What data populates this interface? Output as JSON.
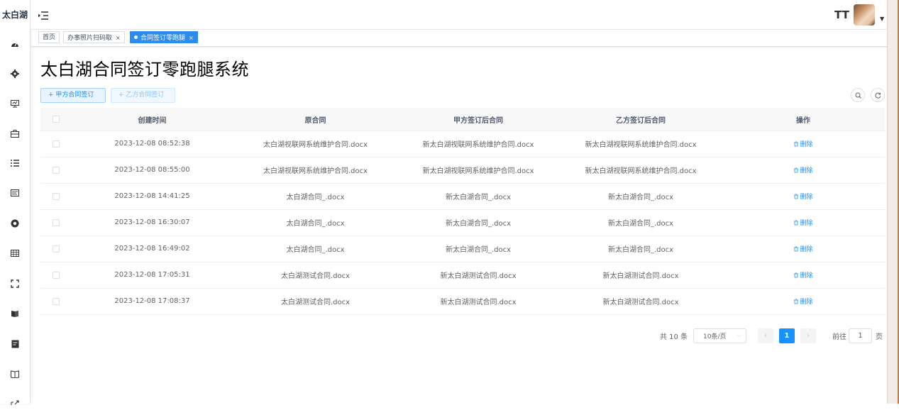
{
  "app": {
    "logo_text": "太白湖"
  },
  "sidebar": {
    "items": [
      {
        "icon": "dashboard-icon"
      },
      {
        "icon": "gear-icon"
      },
      {
        "icon": "monitor-icon"
      },
      {
        "icon": "toolbox-icon"
      },
      {
        "icon": "list-icon"
      },
      {
        "icon": "message-icon"
      },
      {
        "icon": "chrome-icon"
      },
      {
        "icon": "table-icon"
      },
      {
        "icon": "fullscreen-icon"
      },
      {
        "icon": "education-icon"
      },
      {
        "icon": "form-icon"
      },
      {
        "icon": "documentation-icon"
      },
      {
        "icon": "link-icon"
      }
    ]
  },
  "header": {
    "font_size_icon": "TT",
    "caret": "▼"
  },
  "tags": {
    "home": "首页",
    "scan": "办事照片扫码取",
    "active": "合同签订零跑腿",
    "close": "×"
  },
  "page": {
    "title": "太白湖合同签订零跑腿系统"
  },
  "toolbar": {
    "party_a": "甲方合同签订",
    "party_b": "乙方合同签订",
    "plus": "+"
  },
  "table": {
    "columns": [
      "创建时间",
      "原合同",
      "甲方签订后合同",
      "乙方签订后合同",
      "操作"
    ],
    "rows": [
      {
        "created": "2023-12-08 08:52:38",
        "original": "太白湖视联网系统维护合同.docx",
        "a_signed": "新太白湖视联网系统维护合同.docx",
        "b_signed": "新太白湖视联网系统维护合同.docx",
        "action": "删除"
      },
      {
        "created": "2023-12-08 08:55:00",
        "original": "太白湖视联网系统维护合同.docx",
        "a_signed": "新太白湖视联网系统维护合同.docx",
        "b_signed": "新太白湖视联网系统维护合同.docx",
        "action": "删除"
      },
      {
        "created": "2023-12-08 14:41:25",
        "original": "太白湖合同_.docx",
        "a_signed": "新太白湖合同_.docx",
        "b_signed": "新太白湖合同_.docx",
        "action": "删除"
      },
      {
        "created": "2023-12-08 16:30:07",
        "original": "太白湖合同_.docx",
        "a_signed": "新太白湖合同_.docx",
        "b_signed": "新太白湖合同_.docx",
        "action": "删除"
      },
      {
        "created": "2023-12-08 16:49:02",
        "original": "太白湖合同_.docx",
        "a_signed": "新太白湖合同_.docx",
        "b_signed": "新太白湖合同_.docx",
        "action": "删除"
      },
      {
        "created": "2023-12-08 17:05:31",
        "original": "太白湖测试合同.docx",
        "a_signed": "新太白湖测试合同.docx",
        "b_signed": "新太白湖测试合同.docx",
        "action": "删除"
      },
      {
        "created": "2023-12-08 17:08:37",
        "original": "太白湖测试合同.docx",
        "a_signed": "新太白湖测试合同.docx",
        "b_signed": "新太白湖测试合同.docx",
        "action": "删除"
      }
    ]
  },
  "pagination": {
    "total": "共 10 条",
    "page_size": "10条/页",
    "prev": "‹",
    "current": "1",
    "next": "›",
    "goto_label": "前往",
    "goto_value": "1",
    "goto_suffix": "页"
  },
  "colors": {
    "accent": "#1890ff",
    "tag_active": "#2d8cf0"
  }
}
